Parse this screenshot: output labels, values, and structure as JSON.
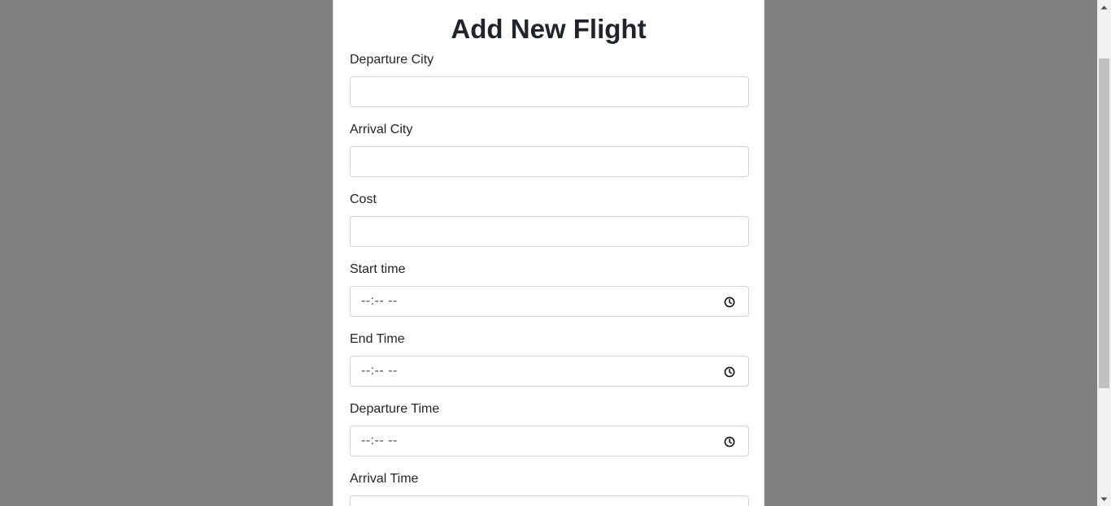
{
  "form": {
    "title": "Add New Flight",
    "fields": [
      {
        "label": "Departure City",
        "value": ""
      },
      {
        "label": "Arrival City",
        "value": ""
      },
      {
        "label": "Cost",
        "value": ""
      },
      {
        "label": "Start time",
        "value": "--:-- --"
      },
      {
        "label": "End Time",
        "value": "--:-- --"
      },
      {
        "label": "Departure Time",
        "value": "--:-- --"
      },
      {
        "label": "Arrival Time",
        "value": ""
      }
    ]
  },
  "icons": {
    "time_picker": "clock-icon",
    "scroll_up": "arrow-up-icon",
    "scroll_down": "arrow-down-icon"
  },
  "colors": {
    "backdrop": "#808080",
    "panel": "#ffffff",
    "input_border": "#ced4da",
    "text": "#212529"
  }
}
